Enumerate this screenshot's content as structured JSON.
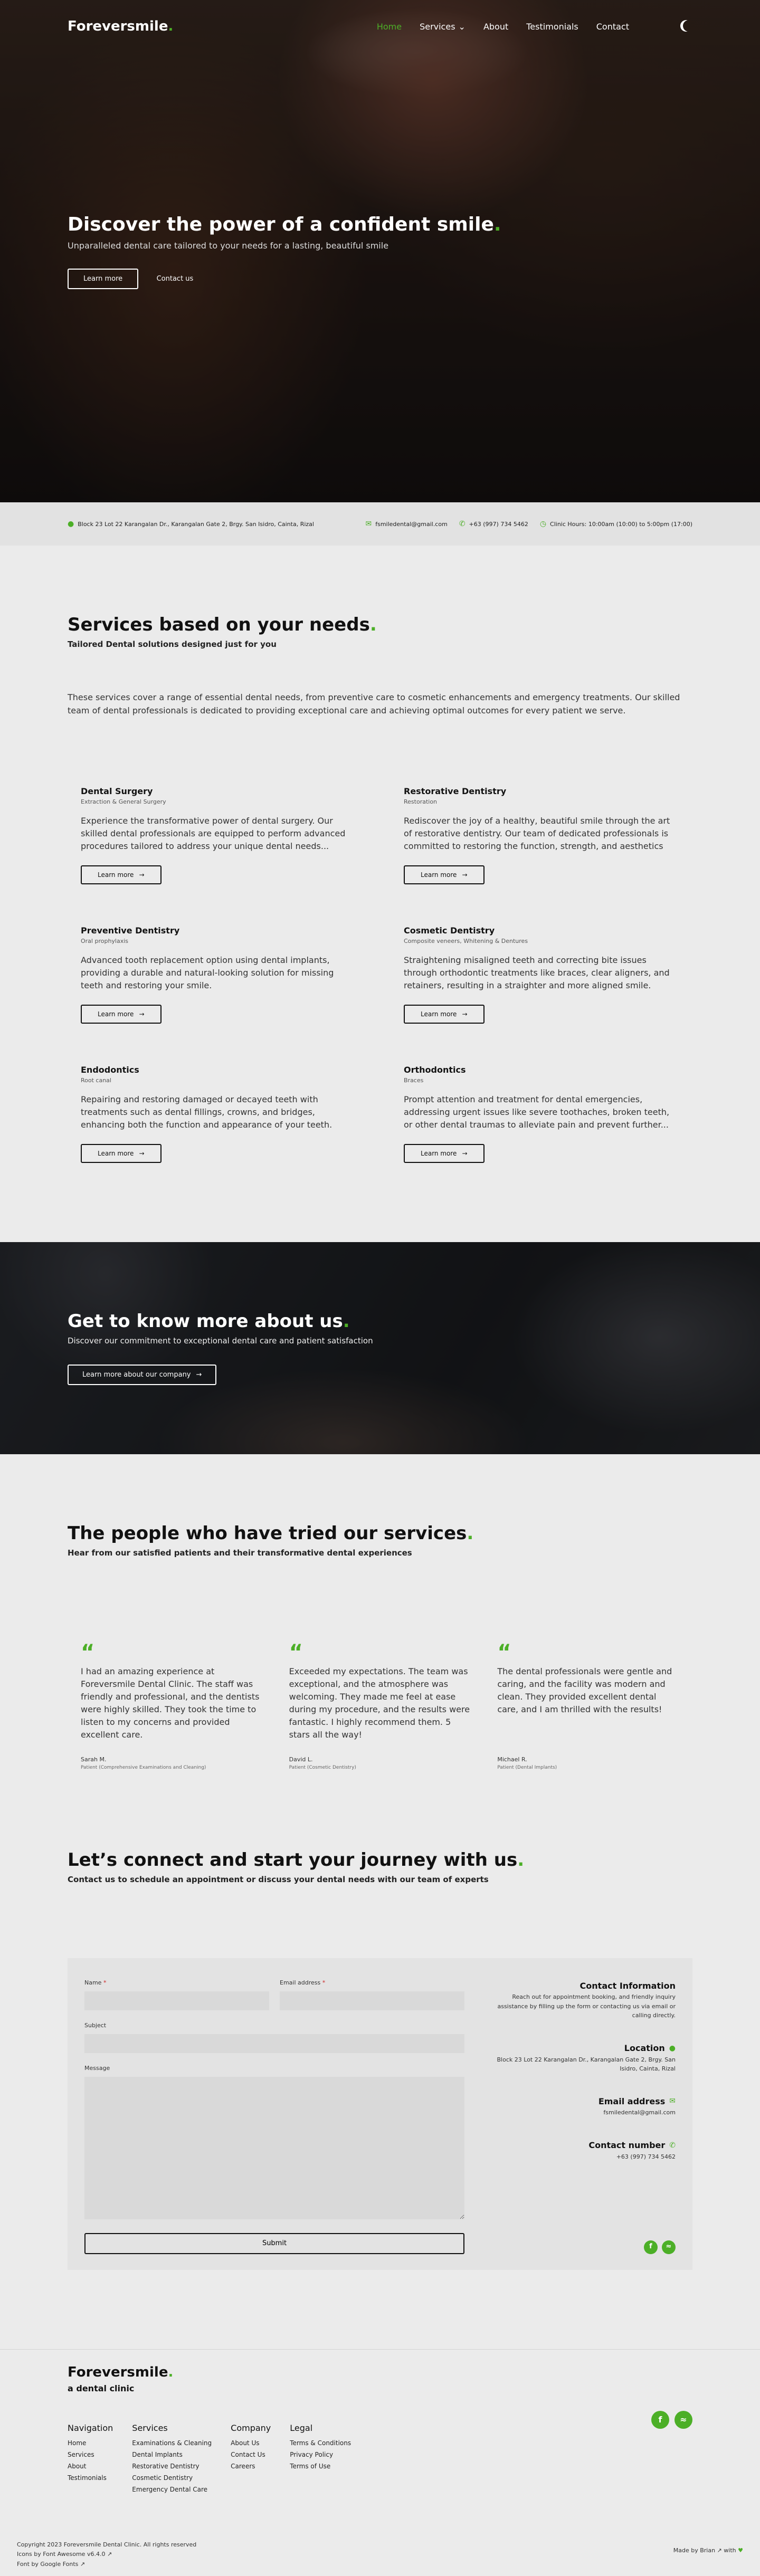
{
  "brand": {
    "name": "Foreversmile",
    "dot": ".",
    "accent": "#4caf27"
  },
  "nav": {
    "items": [
      "Home",
      "Services",
      "About",
      "Testimonials",
      "Contact"
    ],
    "active": "Home",
    "theme_icon": "moon-icon"
  },
  "hero": {
    "title": "Discover the power of a confident smile",
    "title_dot": ".",
    "subtitle": "Unparalleled dental care tailored to your needs for a lasting, beautiful smile",
    "primary_button": "Learn more",
    "secondary_button": "Contact us"
  },
  "infobar": {
    "address": "Block 23 Lot 22 Karangalan Dr., Karangalan Gate 2, Brgy. San Isidro, Cainta, Rizal",
    "email": "fsmiledental@gmail.com",
    "phone": "+63 (997) 734 5462",
    "hours": "Clinic Hours: 10:00am (10:00) to 5:00pm (17:00)"
  },
  "services": {
    "title": "Services based on your needs",
    "title_dot": ".",
    "subtitle": "Tailored Dental solutions designed just for you",
    "intro": "These services cover a range of essential dental needs, from preventive care to cosmetic enhancements and emergency treatments. Our skilled team of dental professionals is dedicated to providing exceptional care and achieving optimal outcomes for every patient we serve.",
    "button": "Learn more",
    "items": [
      {
        "name": "Dental Surgery",
        "category": "Extraction & General Surgery",
        "desc": "Experience the transformative power of dental surgery. Our skilled dental professionals are equipped to perform advanced procedures tailored to address your unique dental needs..."
      },
      {
        "name": "Restorative Dentistry",
        "category": "Restoration",
        "desc": "Rediscover the joy of a healthy, beautiful smile through the art of restorative dentistry. Our team of dedicated professionals is committed to restoring the function, strength, and aesthetics of..."
      },
      {
        "name": "Preventive Dentistry",
        "category": "Oral prophylaxis",
        "desc": "Advanced tooth replacement option using dental implants, providing a durable and natural-looking solution for missing teeth and restoring your smile."
      },
      {
        "name": "Cosmetic Dentistry",
        "category": "Composite veneers, Whitening & Dentures",
        "desc": "Straightening misaligned teeth and correcting bite issues through orthodontic treatments like braces, clear aligners, and retainers, resulting in a straighter and more aligned smile."
      },
      {
        "name": "Endodontics",
        "category": "Root canal",
        "desc": "Repairing and restoring damaged or decayed teeth with treatments such as dental fillings, crowns, and bridges, enhancing both the function and appearance of your teeth."
      },
      {
        "name": "Orthodontics",
        "category": "Braces",
        "desc": "Prompt attention and treatment for dental emergencies, addressing urgent issues like severe toothaches, broken teeth, or other dental traumas to alleviate pain and prevent further..."
      }
    ]
  },
  "about": {
    "title": "Get to know more about us",
    "title_dot": ".",
    "subtitle": "Discover our commitment to exceptional dental care and patient satisfaction",
    "button": "Learn more about our company"
  },
  "testimonials": {
    "title": "The people who have tried our services",
    "title_dot": ".",
    "subtitle": "Hear from our satisfied patients and their transformative dental experiences",
    "quote_mark": "“",
    "items": [
      {
        "text": "I had an amazing experience at Foreversmile Dental Clinic. The staff was friendly and professional, and the dentists were highly skilled. They took the time to listen to my concerns and provided excellent care.",
        "name": "Sarah M.",
        "role": "Patient (Comprehensive Examinations and Cleaning)"
      },
      {
        "text": "Exceeded my expectations. The team was exceptional, and the atmosphere was welcoming. They made me feel at ease during my procedure, and the results were fantastic. I highly recommend them. 5 stars all the way!",
        "name": "David L.",
        "role": "Patient (Cosmetic Dentistry)"
      },
      {
        "text": "The dental professionals were gentle and caring, and the facility was modern and clean. They provided excellent dental care, and I am thrilled with the results!",
        "name": "Michael R.",
        "role": "Patient (Dental Implants)"
      }
    ]
  },
  "contact": {
    "title": "Let’s connect and start your journey with us",
    "title_dot": ".",
    "subtitle": "Contact us to schedule an appointment or discuss your dental needs with our team of experts",
    "form": {
      "name_label": "Name",
      "email_label": "Email address",
      "required_mark": "*",
      "subject_label": "Subject",
      "message_label": "Message",
      "submit": "Submit"
    },
    "info": {
      "title": "Contact Information",
      "text": "Reach out for appointment booking, and friendly inquiry assistance by filling up the form or contacting us via email or calling directly.",
      "location_title": "Location",
      "location": "Block 23 Lot 22 Karangalan Dr., Karangalan Gate 2, Brgy. San Isidro, Cainta, Rizal",
      "email_title": "Email address",
      "email": "fsmiledental@gmail.com",
      "phone_title": "Contact number",
      "phone": "+63 (997) 734 5462"
    }
  },
  "footer": {
    "tagline": "a dental clinic",
    "columns": [
      {
        "title": "Navigation",
        "links": [
          "Home",
          "Services",
          "About",
          "Testimonials"
        ]
      },
      {
        "title": "Services",
        "links": [
          "Examinations & Cleaning",
          "Dental Implants",
          "Restorative Dentistry",
          "Cosmetic Dentistry",
          "Emergency Dental Care"
        ]
      },
      {
        "title": "Company",
        "links": [
          "About Us",
          "Contact Us",
          "Careers"
        ]
      },
      {
        "title": "Legal",
        "links": [
          "Terms & Conditions",
          "Privacy Policy",
          "Terms of Use"
        ]
      }
    ],
    "copyright": "Copyright 2023 Foreversmile Dental Clinic. All rights reserved",
    "icons_credit": "Icons by Font Awesome v6.4.0",
    "font_credit": "Font by Google Fonts",
    "made_by": "Made by Brian",
    "made_with": "with"
  }
}
